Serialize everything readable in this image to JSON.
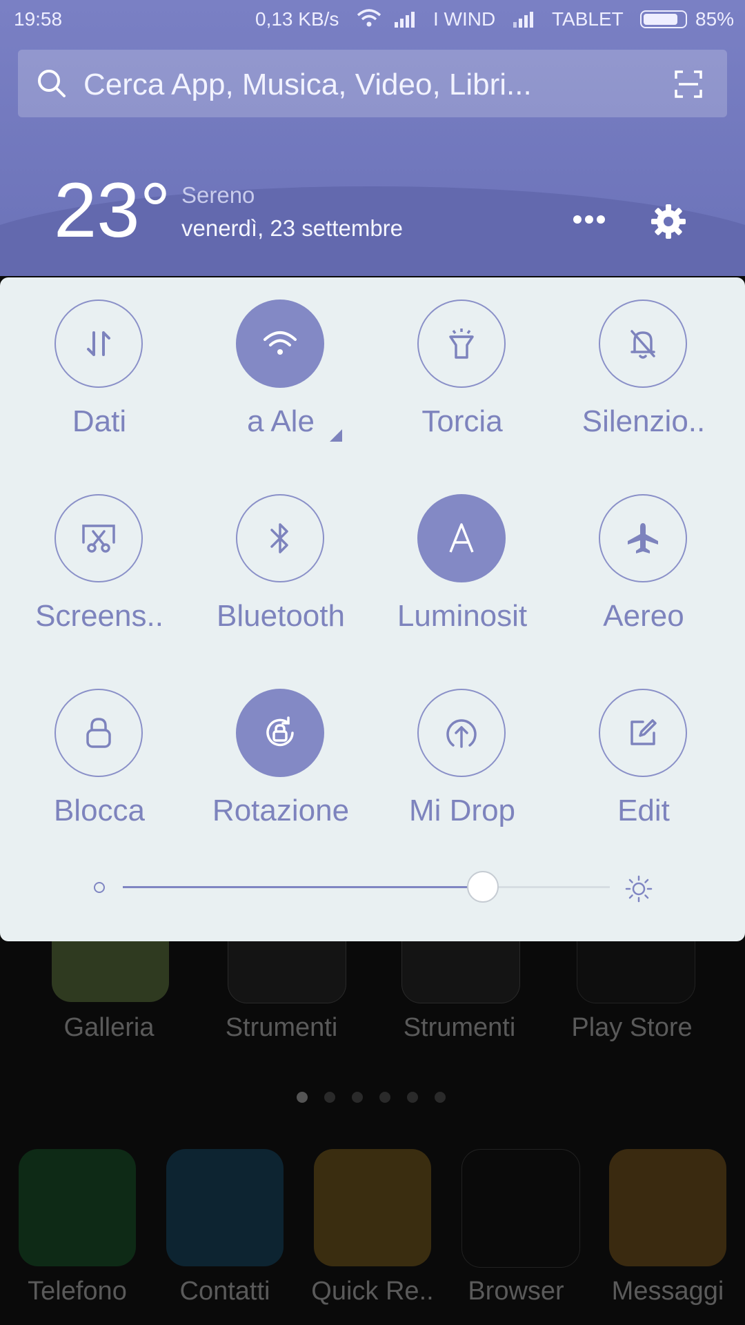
{
  "status_bar": {
    "time": "19:58",
    "speed": "0,13 KB/s",
    "carrier1": "I WIND",
    "carrier2": "TABLET",
    "battery": "85%",
    "battery_level": 0.85
  },
  "search": {
    "placeholder": "Cerca App, Musica, Video, Libri..."
  },
  "weather": {
    "temperature": "23°",
    "condition": "Sereno",
    "date": "venerdì, 23 settembre"
  },
  "tiles": [
    {
      "label": "Dati",
      "icon": "data-arrows-icon",
      "active": false
    },
    {
      "label": "a   Ale",
      "icon": "wifi-icon",
      "active": true
    },
    {
      "label": "Torcia",
      "icon": "flashlight-icon",
      "active": false
    },
    {
      "label": "Silenzio..",
      "icon": "bell-off-icon",
      "active": false
    },
    {
      "label": "Screens..",
      "icon": "screenshot-icon",
      "active": false
    },
    {
      "label": "Bluetooth",
      "icon": "bluetooth-icon",
      "active": false
    },
    {
      "label": "Luminosit",
      "icon": "auto-brightness-icon",
      "active": true
    },
    {
      "label": "Aereo",
      "icon": "airplane-icon",
      "active": false
    },
    {
      "label": "Blocca",
      "icon": "lock-icon",
      "active": false
    },
    {
      "label": "Rotazione",
      "icon": "rotation-lock-icon",
      "active": true
    },
    {
      "label": "Mi Drop",
      "icon": "upload-icon",
      "active": false
    },
    {
      "label": "Edit",
      "icon": "edit-icon",
      "active": false
    }
  ],
  "brightness": {
    "level": 0.74
  },
  "home": {
    "row1": [
      "Galleria",
      "Strumenti",
      "Strumenti",
      "Play Store"
    ],
    "dock": [
      "Telefono",
      "Contatti",
      "Quick Re..",
      "Browser",
      "Messaggi"
    ],
    "page_count": 6,
    "current_page": 1
  }
}
